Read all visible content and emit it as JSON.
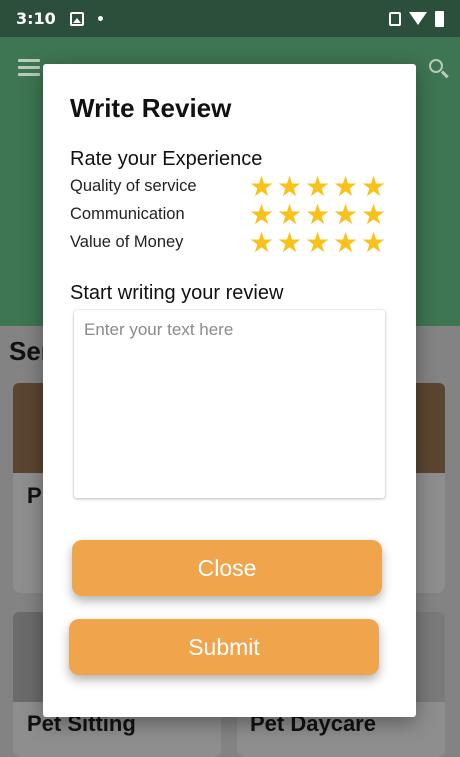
{
  "status_bar": {
    "time": "3:10"
  },
  "background": {
    "section_title": "Ser",
    "cards": [
      {
        "title": "P"
      },
      {
        "title": "Pet Sitting"
      },
      {
        "title": "Pet Daycare"
      }
    ]
  },
  "dialog": {
    "title": "Write Review",
    "rate_heading": "Rate your Experience",
    "ratings": [
      {
        "label": "Quality of service",
        "stars": 5
      },
      {
        "label": "Communication",
        "stars": 5
      },
      {
        "label": "Value of Money",
        "stars": 5
      }
    ],
    "review_heading": "Start writing your review",
    "review_input": {
      "placeholder": "Enter your text here",
      "value": ""
    },
    "close_label": "Close",
    "submit_label": "Submit"
  },
  "colors": {
    "app_green": "#3e7552",
    "button_orange": "#f0a44b",
    "star_yellow": "#f8c21a"
  }
}
